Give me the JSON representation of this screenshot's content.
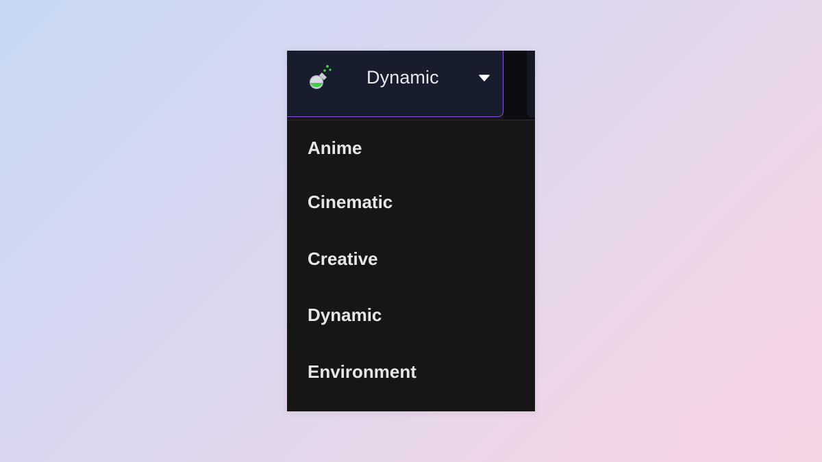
{
  "dropdown": {
    "selected": "Dynamic",
    "trigger_icon": "flask-icon",
    "caret_icon": "caret-down-icon",
    "accent_color": "#8a4fe0",
    "icon_color": "#4cc94c",
    "options": [
      "Anime",
      "Cinematic",
      "Creative",
      "Dynamic",
      "Environment"
    ]
  }
}
